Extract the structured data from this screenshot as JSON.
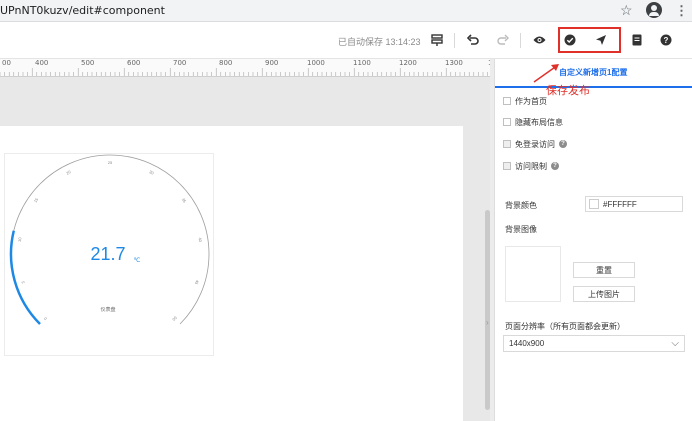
{
  "browser": {
    "url": "UPnNT0kuzv/edit#component",
    "bookmark_icon": "star-icon",
    "profile_icon": "account-circle-icon",
    "menu_icon": "more-vert-icon"
  },
  "toolbar": {
    "autosave": "已自动保存 13:14:23",
    "icons": [
      "layers-icon",
      "undo-icon",
      "redo-icon",
      "preview-eye-icon",
      "save-check-icon",
      "publish-send-icon",
      "document-icon",
      "help-icon"
    ]
  },
  "ruler": {
    "labels": [
      "00",
      "400",
      "500",
      "600",
      "700",
      "800",
      "900",
      "1000",
      "1100",
      "1200",
      "1300",
      "1400",
      "1"
    ]
  },
  "annotation": {
    "text": "保存发布"
  },
  "gauge": {
    "value": "21.7",
    "unit": "℃",
    "label": "仪表盘",
    "min": 0,
    "max": 100,
    "ticks": [
      "0",
      "5",
      "10",
      "15",
      "20",
      "25",
      "30",
      "35",
      "40",
      "45",
      "50"
    ],
    "progress_color": "#1e88e5"
  },
  "panel": {
    "tab_label": "自定义新增页1配置",
    "checkboxes": [
      {
        "label": "作为首页",
        "help": false,
        "disabled": false
      },
      {
        "label": "隐藏布局信息",
        "help": false,
        "disabled": false
      },
      {
        "label": "免登录访问",
        "help": true,
        "disabled": true
      },
      {
        "label": "访问限制",
        "help": true,
        "disabled": true
      }
    ],
    "bg_color_label": "背景颜色",
    "bg_color_value": "#FFFFFF",
    "bg_image_label": "背景图像",
    "reset_button": "重置",
    "upload_button": "上传图片",
    "resolution_label": "页面分辨率（所有页面都会更新）",
    "resolution_value": "1440x900"
  },
  "colors": {
    "accent": "#1f6feb",
    "annotation": "#e0302a"
  }
}
